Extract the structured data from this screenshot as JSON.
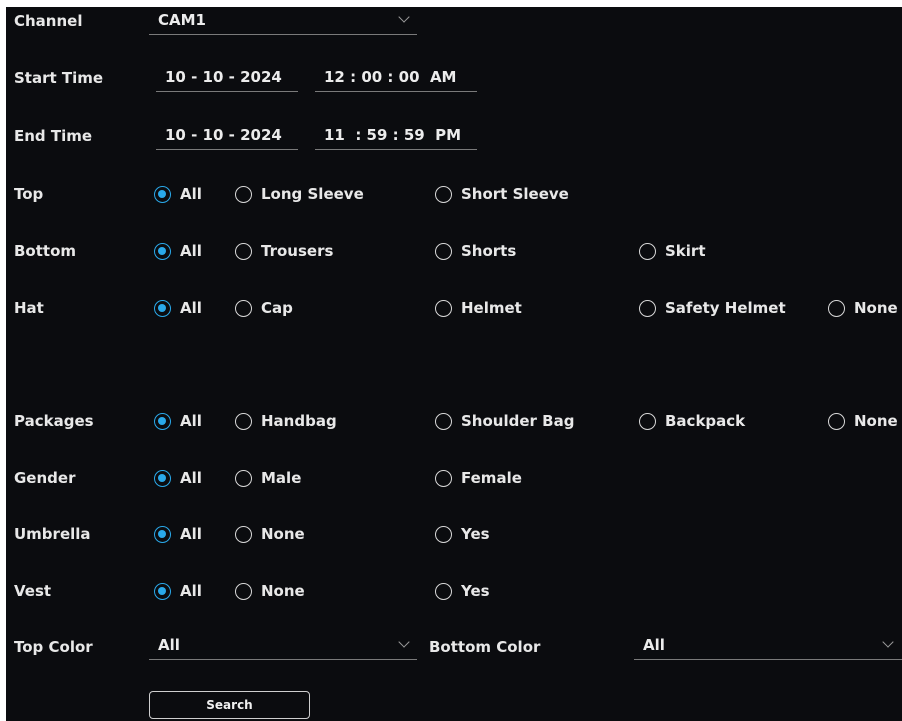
{
  "channel": {
    "label": "Channel",
    "value": "CAM1"
  },
  "start_time": {
    "label": "Start Time",
    "date": "10 - 10 - 2024",
    "time": "12 : 00 : 00  AM"
  },
  "end_time": {
    "label": "End Time",
    "date": "10 - 10 - 2024",
    "time": "11  : 59 : 59  PM"
  },
  "top": {
    "label": "Top",
    "selected": "All",
    "options": [
      "All",
      "Long Sleeve",
      "Short Sleeve"
    ]
  },
  "bottom": {
    "label": "Bottom",
    "selected": "All",
    "options": [
      "All",
      "Trousers",
      "Shorts",
      "Skirt"
    ]
  },
  "hat": {
    "label": "Hat",
    "selected": "All",
    "options": [
      "All",
      "Cap",
      "Helmet",
      "Safety Helmet",
      "None"
    ]
  },
  "packages": {
    "label": "Packages",
    "selected": "All",
    "options": [
      "All",
      "Handbag",
      "Shoulder Bag",
      "Backpack",
      "None"
    ]
  },
  "gender": {
    "label": "Gender",
    "selected": "All",
    "options": [
      "All",
      "Male",
      "Female"
    ]
  },
  "umbrella": {
    "label": "Umbrella",
    "selected": "All",
    "options": [
      "All",
      "None",
      "Yes"
    ]
  },
  "vest": {
    "label": "Vest",
    "selected": "All",
    "options": [
      "All",
      "None",
      "Yes"
    ]
  },
  "top_color": {
    "label": "Top Color",
    "value": "All"
  },
  "bottom_color": {
    "label": "Bottom Color",
    "value": "All"
  },
  "search_label": "Search",
  "colors": {
    "background": "#0b0c0f",
    "accent": "#2aa9ea",
    "text": "#e8e8e8"
  },
  "icons": {
    "dropdown": "chevron-down-icon",
    "radio_on": "radio-selected-icon",
    "radio_off": "radio-unselected-icon"
  }
}
